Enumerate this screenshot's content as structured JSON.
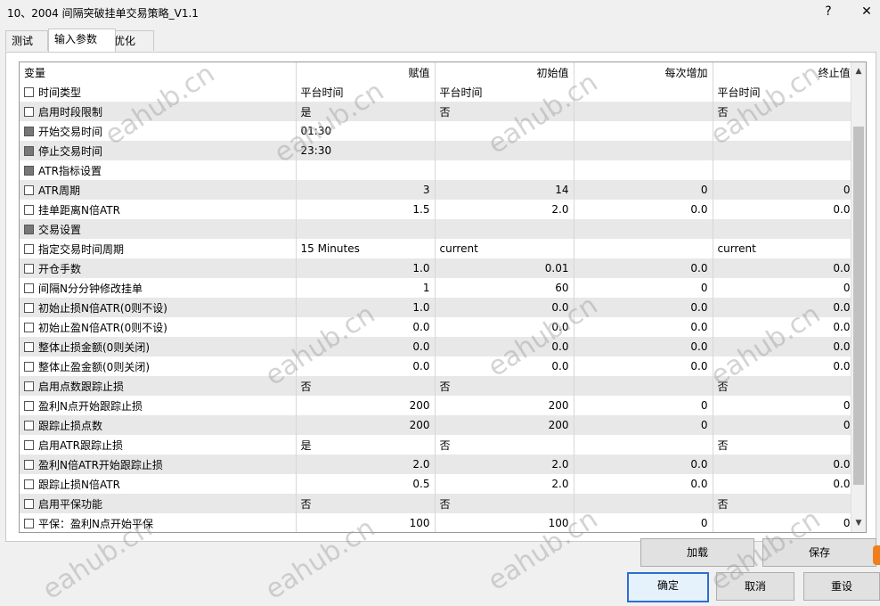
{
  "window": {
    "title": "10、2004 间隔突破挂单交易策略_V1.1",
    "help": "?",
    "close": "✕"
  },
  "tabs": [
    "测试",
    "输入参数",
    "优化"
  ],
  "columns": [
    "变量",
    "赋值",
    "初始值",
    "每次增加",
    "终止值"
  ],
  "rows": [
    {
      "name": "时间类型",
      "group": false,
      "value": "平台时间",
      "start": "平台时间",
      "step": "",
      "stop": "平台时间"
    },
    {
      "name": "启用时段限制",
      "group": false,
      "value": "是",
      "start": "否",
      "step": "",
      "stop": "否"
    },
    {
      "name": "开始交易时间",
      "group": true,
      "value": "01:30",
      "start": "",
      "step": "",
      "stop": ""
    },
    {
      "name": "停止交易时间",
      "group": true,
      "value": "23:30",
      "start": "",
      "step": "",
      "stop": ""
    },
    {
      "name": "ATR指标设置",
      "group": true,
      "value": "",
      "start": "",
      "step": "",
      "stop": ""
    },
    {
      "name": "ATR周期",
      "group": false,
      "value": "3",
      "start": "14",
      "step": "0",
      "stop": "0"
    },
    {
      "name": "挂单距离N倍ATR",
      "group": false,
      "value": "1.5",
      "start": "2.0",
      "step": "0.0",
      "stop": "0.0"
    },
    {
      "name": "交易设置",
      "group": true,
      "value": "",
      "start": "",
      "step": "",
      "stop": ""
    },
    {
      "name": "指定交易时间周期",
      "group": false,
      "value": "15 Minutes",
      "start": "current",
      "step": "",
      "stop": "current"
    },
    {
      "name": "开仓手数",
      "group": false,
      "value": "1.0",
      "start": "0.01",
      "step": "0.0",
      "stop": "0.0"
    },
    {
      "name": "间隔N分分钟修改挂单",
      "group": false,
      "value": "1",
      "start": "60",
      "step": "0",
      "stop": "0"
    },
    {
      "name": "初始止损N倍ATR(0则不设)",
      "group": false,
      "value": "1.0",
      "start": "0.0",
      "step": "0.0",
      "stop": "0.0"
    },
    {
      "name": "初始止盈N倍ATR(0则不设)",
      "group": false,
      "value": "0.0",
      "start": "0.0",
      "step": "0.0",
      "stop": "0.0"
    },
    {
      "name": "整体止损金额(0则关闭)",
      "group": false,
      "value": "0.0",
      "start": "0.0",
      "step": "0.0",
      "stop": "0.0"
    },
    {
      "name": "整体止盈金额(0则关闭)",
      "group": false,
      "value": "0.0",
      "start": "0.0",
      "step": "0.0",
      "stop": "0.0"
    },
    {
      "name": "启用点数跟踪止损",
      "group": false,
      "value": "否",
      "start": "否",
      "step": "",
      "stop": "否"
    },
    {
      "name": "盈利N点开始跟踪止损",
      "group": false,
      "value": "200",
      "start": "200",
      "step": "0",
      "stop": "0"
    },
    {
      "name": "跟踪止损点数",
      "group": false,
      "value": "200",
      "start": "200",
      "step": "0",
      "stop": "0"
    },
    {
      "name": "启用ATR跟踪止损",
      "group": false,
      "value": "是",
      "start": "否",
      "step": "",
      "stop": "否"
    },
    {
      "name": "盈利N倍ATR开始跟踪止损",
      "group": false,
      "value": "2.0",
      "start": "2.0",
      "step": "0.0",
      "stop": "0.0"
    },
    {
      "name": "跟踪止损N倍ATR",
      "group": false,
      "value": "0.5",
      "start": "2.0",
      "step": "0.0",
      "stop": "0.0"
    },
    {
      "name": "启用平保功能",
      "group": false,
      "value": "否",
      "start": "否",
      "step": "",
      "stop": "否"
    },
    {
      "name": "平保：盈利N点开始平保",
      "group": false,
      "value": "100",
      "start": "100",
      "step": "0",
      "stop": "0"
    }
  ],
  "buttons": {
    "load": "加载",
    "save": "保存",
    "ok": "确定",
    "cancel": "取消",
    "reset": "重设"
  },
  "scroll": {
    "up_icon": "chevron-up-icon",
    "down_icon": "chevron-down-icon"
  },
  "watermark": "eahub.cn"
}
